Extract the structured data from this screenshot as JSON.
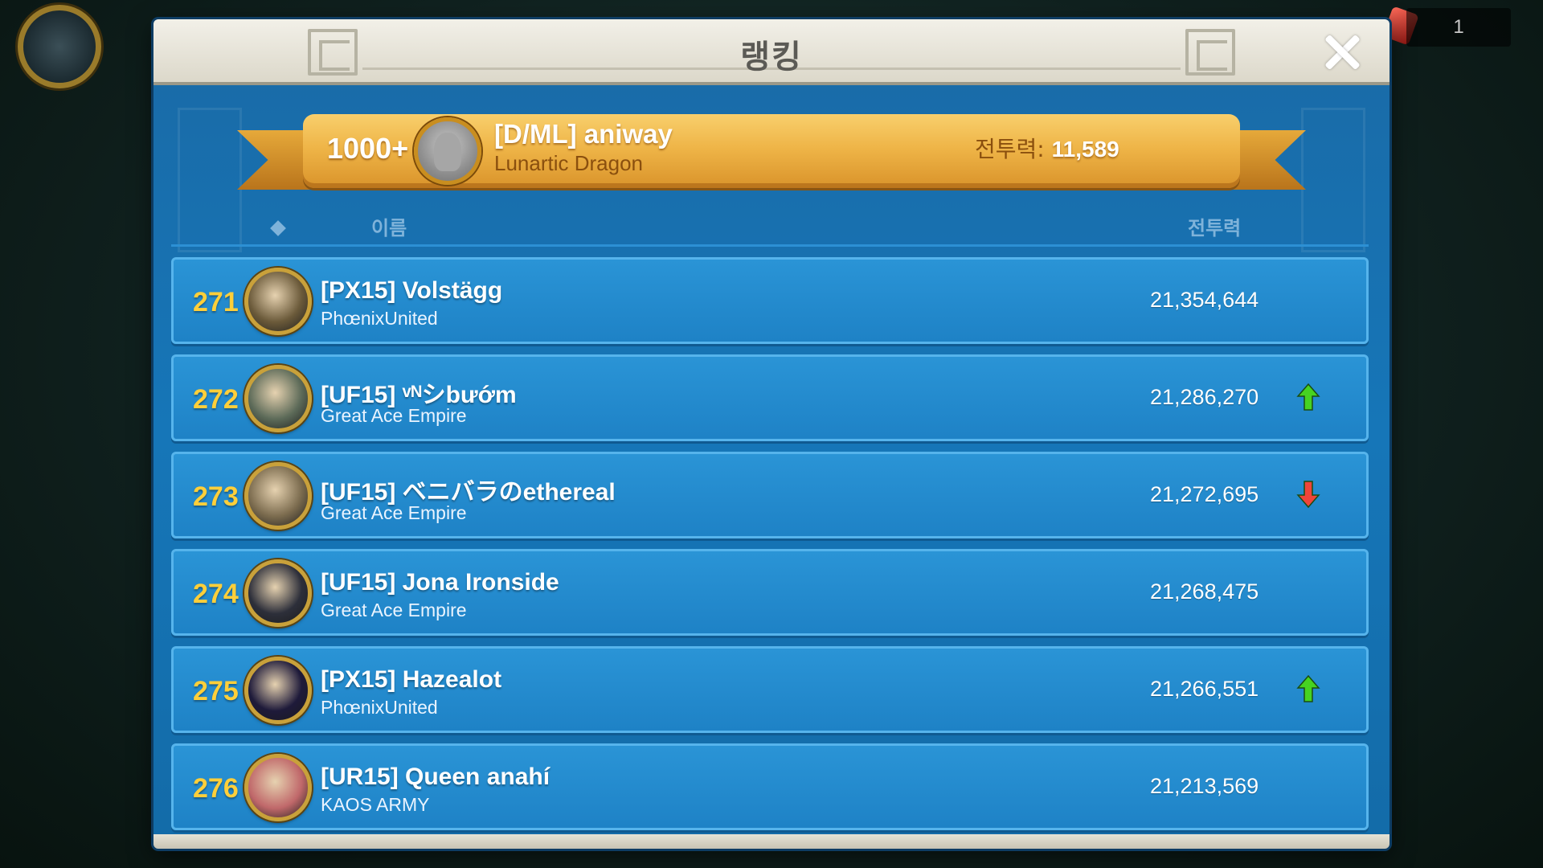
{
  "background": {
    "top_right_counter": "1"
  },
  "modal": {
    "title": "랭킹"
  },
  "own_rank": {
    "rank": "1000+",
    "name": "[D/ML] aniway",
    "guild": "Lunartic Dragon",
    "power_label": "전투력:",
    "power_value": "11,589"
  },
  "columns": {
    "name": "이름",
    "power": "전투력"
  },
  "rows": [
    {
      "rank": "271",
      "name": "[PX15] Volstägg",
      "guild": "PhœnixUnited",
      "power": "21,354,644",
      "trend": "none",
      "avatar_color": "#6b5a3a"
    },
    {
      "rank": "272",
      "name": "[UF15] ᵛᴺシbướm",
      "guild": "Great Ace Empire",
      "power": "21,286,270",
      "trend": "up",
      "avatar_color": "#5c6a58"
    },
    {
      "rank": "273",
      "name": "[UF15] ベニバラのethereal",
      "guild": "Great Ace Empire",
      "power": "21,272,695",
      "trend": "down",
      "avatar_color": "#7b6b4e"
    },
    {
      "rank": "274",
      "name": "[UF15] Jona Ironside",
      "guild": "Great Ace Empire",
      "power": "21,268,475",
      "trend": "none",
      "avatar_color": "#2d2f3a"
    },
    {
      "rank": "275",
      "name": "[PX15] Hazealot",
      "guild": "PhœnixUnited",
      "power": "21,266,551",
      "trend": "up",
      "avatar_color": "#1e1a3a"
    },
    {
      "rank": "276",
      "name": "[UR15] Queen anahí",
      "guild": "KAOS ARMY",
      "power": "21,213,569",
      "trend": "none",
      "avatar_color": "#c0686a"
    }
  ],
  "colors": {
    "trend_up": "#46d321",
    "trend_down": "#f0443a",
    "rank_gold": "#ffcf3a"
  }
}
